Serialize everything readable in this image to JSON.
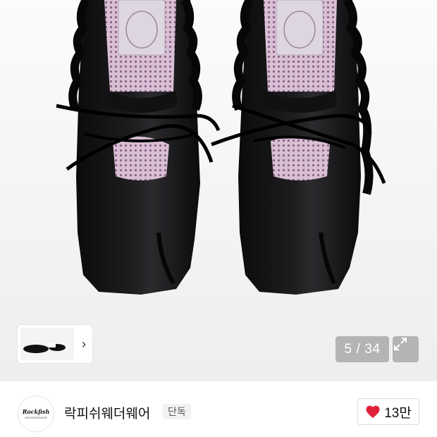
{
  "gallery": {
    "counter_current": "5",
    "counter_separator": "/",
    "counter_total": "34",
    "thumb_next_icon": "chevron-right-icon",
    "expand_icon": "expand-arrows-icon"
  },
  "store": {
    "logo_brand": "Rockfish",
    "logo_sub": "WEATHERWEAR",
    "name": "락피쉬웨더웨어",
    "badge": "단독",
    "like_icon": "heart-icon",
    "like_count": "13만"
  },
  "colors": {
    "heart": "#e02238",
    "shoe": "#0f0f10",
    "insole": "#c9a6c3"
  }
}
